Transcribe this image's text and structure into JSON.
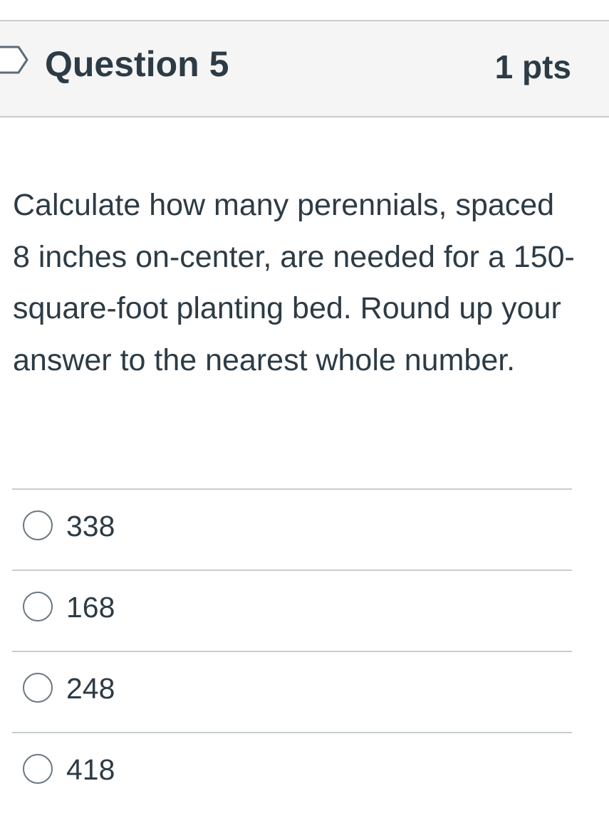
{
  "question": {
    "title": "Question 5",
    "points": "1 pts",
    "flag_icon": "flag-outline-icon",
    "text": "Calculate how many perennials, spaced 8 inches on-center, are needed for a 150-square-foot planting bed. Round up your answer to the nearest whole number."
  },
  "answers": [
    {
      "label": "338",
      "selected": false
    },
    {
      "label": "168",
      "selected": false
    },
    {
      "label": "248",
      "selected": false
    },
    {
      "label": "418",
      "selected": false
    }
  ],
  "colors": {
    "text": "#2d3b45",
    "header_background": "#f5f5f5",
    "divider": "#c7cdd1",
    "radio_border": "#6b7780"
  }
}
